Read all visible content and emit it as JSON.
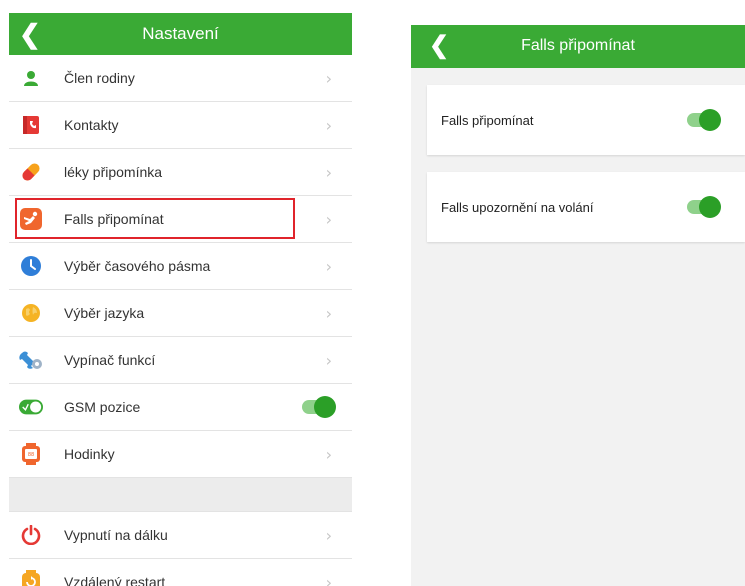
{
  "left_screen": {
    "title": "Nastavení",
    "items": [
      {
        "label": "Člen rodiny",
        "icon": "person-icon"
      },
      {
        "label": "Kontakty",
        "icon": "contacts-icon"
      },
      {
        "label": "léky připomínka",
        "icon": "pill-icon"
      },
      {
        "label": "Falls připomínat",
        "icon": "fall-icon",
        "highlighted": true
      },
      {
        "label": "Výběr časového pásma",
        "icon": "clock-icon"
      },
      {
        "label": "Výběr jazyka",
        "icon": "globe-icon"
      },
      {
        "label": "Vypínač funkcí",
        "icon": "wrench-icon"
      },
      {
        "label": "GSM pozice",
        "icon": "toggle-icon",
        "toggle": true,
        "toggle_on": true
      },
      {
        "label": "Hodinky",
        "icon": "watch-icon"
      }
    ],
    "items2": [
      {
        "label": "Vypnutí na dálku",
        "icon": "power-icon"
      },
      {
        "label": "Vzdálený restart",
        "icon": "restart-icon"
      }
    ]
  },
  "right_screen": {
    "title": "Falls připomínat",
    "cards": [
      {
        "label": "Falls připomínat",
        "toggle_on": true
      },
      {
        "label": "Falls upozornění na volání",
        "toggle_on": true
      }
    ]
  },
  "colors": {
    "accent": "#3aaa35",
    "toggle_knob": "#2b9f27",
    "highlight": "#e0242b"
  }
}
